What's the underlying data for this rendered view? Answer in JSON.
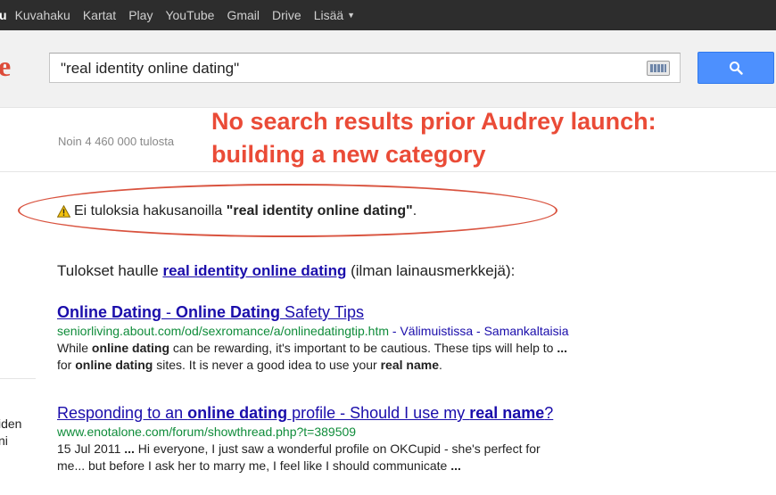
{
  "topbar": {
    "first_item": "u",
    "items": [
      "Kuvahaku",
      "Kartat",
      "Play",
      "YouTube",
      "Gmail",
      "Drive"
    ],
    "more_label": "Lisää"
  },
  "header": {
    "logo_fragment": "e",
    "search_query": "\"real identity online dating\""
  },
  "stats": "Noin 4 460 000 tulosta",
  "annotation": {
    "line1": "No search results prior Audrey launch:",
    "line2": "building a new category"
  },
  "no_results": {
    "prefix": "Ei tuloksia hakusanoilla",
    "query": "\"real identity online dating\"",
    "suffix": "."
  },
  "results_for": {
    "prefix": "Tulokset haulle",
    "link": "real identity online dating",
    "suffix": "(ilman lainausmerkkejä):"
  },
  "results": [
    {
      "title_b1": "Online Dating",
      "title_mid": " - ",
      "title_b2": "Online Dating",
      "title_end": " Safety Tips",
      "url": "seniorliving.about.com/od/sexromance/a/onlinedatingtip.htm",
      "links": " - Välimuistissa - Samankaltaisia",
      "snippet1_a": "While ",
      "snippet1_b": "online dating",
      "snippet1_c": " can be rewarding, it's important to be cautious. These tips will help to ",
      "snippet1_d": "...",
      "snippet2_a": "for ",
      "snippet2_b": "online dating",
      "snippet2_c": " sites. It is never a good idea to use your ",
      "snippet2_d": "real name",
      "snippet2_e": "."
    },
    {
      "title_a": "Responding to an ",
      "title_b1": "online dating",
      "title_mid": " profile - Should I use my ",
      "title_b2": "real name",
      "title_end": "?",
      "url": "www.enotalone.com/forum/showthread.php?t=389509",
      "snippet1_a": "15 Jul 2011 ",
      "snippet1_b": "...",
      "snippet1_c": " Hi everyone, I just saw a wonderful profile on OKCupid - she's perfect for",
      "snippet2_a": "me... but before I ask her to marry me, I feel like I should communicate ",
      "snippet2_b": "..."
    }
  ],
  "side_fragment": {
    "line1": "iden",
    "line2": "ni"
  }
}
